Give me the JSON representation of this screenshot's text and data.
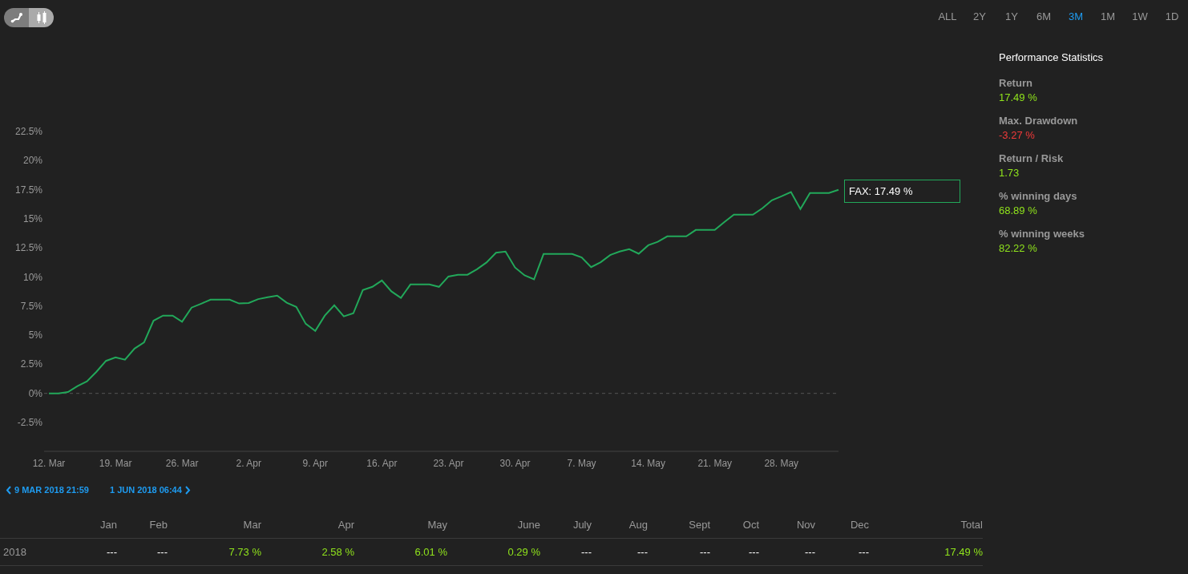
{
  "chart_types": [
    {
      "selected": true
    },
    {
      "selected": false
    }
  ],
  "ranges": [
    {
      "label": "ALL",
      "selected": false
    },
    {
      "label": "2Y",
      "selected": false
    },
    {
      "label": "1Y",
      "selected": false
    },
    {
      "label": "6M",
      "selected": false
    },
    {
      "label": "3M",
      "selected": true
    },
    {
      "label": "1M",
      "selected": false
    },
    {
      "label": "1W",
      "selected": false
    },
    {
      "label": "1D",
      "selected": false
    }
  ],
  "chart": {
    "tooltip": "FAX: 17.49 %",
    "chart_data": {
      "type": "line",
      "ylim": [
        -2.5,
        22.5
      ],
      "yticks": [
        {
          "value": -2.5,
          "label": "-2.5%"
        },
        {
          "value": 0,
          "label": "0%"
        },
        {
          "value": 2.5,
          "label": "2.5%"
        },
        {
          "value": 5,
          "label": "5%"
        },
        {
          "value": 7.5,
          "label": "7.5%"
        },
        {
          "value": 10,
          "label": "10%"
        },
        {
          "value": 12.5,
          "label": "12.5%"
        },
        {
          "value": 15,
          "label": "15%"
        },
        {
          "value": 17.5,
          "label": "17.5%"
        },
        {
          "value": 20,
          "label": "20%"
        },
        {
          "value": 22.5,
          "label": "22.5%"
        }
      ],
      "categories": [
        "12. Mar",
        null,
        null,
        null,
        null,
        null,
        null,
        "19. Mar",
        null,
        null,
        null,
        null,
        null,
        null,
        "26. Mar",
        null,
        null,
        null,
        null,
        null,
        null,
        "2. Apr",
        null,
        null,
        null,
        null,
        null,
        null,
        "9. Apr",
        null,
        null,
        null,
        null,
        null,
        null,
        "16. Apr",
        null,
        null,
        null,
        null,
        null,
        null,
        "23. Apr",
        null,
        null,
        null,
        null,
        null,
        null,
        "30. Apr",
        null,
        null,
        null,
        null,
        null,
        null,
        "7. May",
        null,
        null,
        null,
        null,
        null,
        null,
        "14. May",
        null,
        null,
        null,
        null,
        null,
        null,
        "21. May",
        null,
        null,
        null,
        null,
        null,
        null,
        "28. May",
        null,
        null,
        null,
        null,
        null,
        null
      ],
      "series": [
        {
          "color": "#22a85a",
          "values": [
            0,
            0,
            0.12,
            0.63,
            1.03,
            1.86,
            2.79,
            3.1,
            2.89,
            3.85,
            4.38,
            6.25,
            6.68,
            6.68,
            6.15,
            7.37,
            7.71,
            8.05,
            8.05,
            8.05,
            7.72,
            7.76,
            8.1,
            8.26,
            8.4,
            7.79,
            7.43,
            5.98,
            5.37,
            6.69,
            7.57,
            6.61,
            6.88,
            8.87,
            9.15,
            9.7,
            8.77,
            8.21,
            9.36,
            9.36,
            9.36,
            9.15,
            10.04,
            10.19,
            10.19,
            10.66,
            11.25,
            12.09,
            12.18,
            10.81,
            10.14,
            9.79,
            11.98,
            11.98,
            11.98,
            11.98,
            11.68,
            10.85,
            11.27,
            11.89,
            12.18,
            12.39,
            12.0,
            12.73,
            13.02,
            13.49,
            13.49,
            13.49,
            14.04,
            14.04,
            14.04,
            14.72,
            15.35,
            15.35,
            15.35,
            15.9,
            16.59,
            16.93,
            17.3,
            15.83,
            17.21,
            17.21,
            17.21,
            17.49
          ]
        }
      ]
    }
  },
  "date_nav": {
    "start": "9 MAR 2018 21:59",
    "end": "1 JUN 2018 06:44"
  },
  "stats": {
    "title": "Performance Statistics",
    "items": [
      {
        "label": "Return",
        "value": "17.49 %",
        "color": "#8fe21c"
      },
      {
        "label": "Max. Drawdown",
        "value": "-3.27 %",
        "color": "#f23a3a"
      },
      {
        "label": "Return / Risk",
        "value": "1.73",
        "color": "#8fe21c"
      },
      {
        "label": "% winning days",
        "value": "68.89 %",
        "color": "#8fe21c"
      },
      {
        "label": "% winning weeks",
        "value": "82.22 %",
        "color": "#8fe21c"
      }
    ]
  },
  "table": {
    "columns": [
      "Jan",
      "Feb",
      "Mar",
      "Apr",
      "May",
      "June",
      "July",
      "Aug",
      "Sept",
      "Oct",
      "Nov",
      "Dec",
      "Total"
    ],
    "rows": [
      {
        "year": "2018",
        "cells": [
          {
            "kind": "empty",
            "text": "---"
          },
          {
            "kind": "empty",
            "text": "---"
          },
          {
            "kind": "value",
            "text": "7.73 %"
          },
          {
            "kind": "value",
            "text": "2.58 %"
          },
          {
            "kind": "value",
            "text": "6.01 %"
          },
          {
            "kind": "value",
            "text": "0.29 %"
          },
          {
            "kind": "empty",
            "text": "---"
          },
          {
            "kind": "empty",
            "text": "---"
          },
          {
            "kind": "empty",
            "text": "---"
          },
          {
            "kind": "empty",
            "text": "---"
          },
          {
            "kind": "empty",
            "text": "---"
          },
          {
            "kind": "empty",
            "text": "---"
          },
          {
            "kind": "value",
            "text": "17.49 %"
          }
        ]
      }
    ]
  }
}
